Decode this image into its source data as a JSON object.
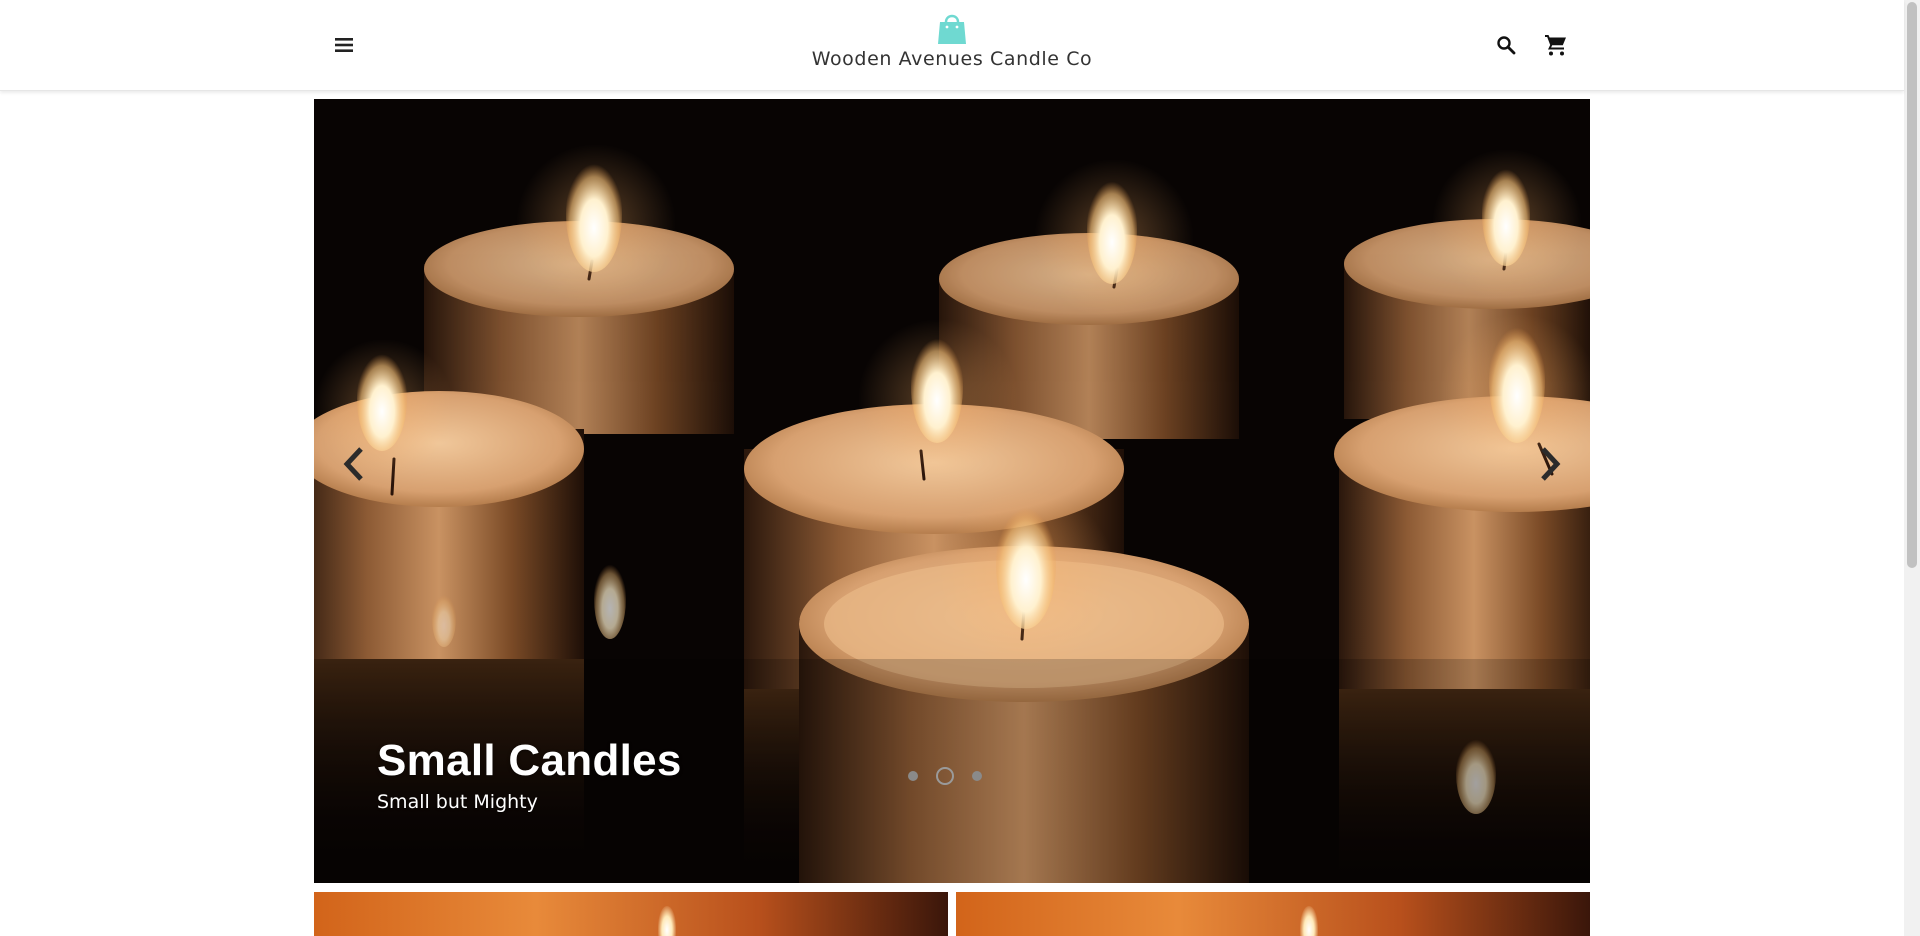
{
  "header": {
    "store_name": "Wooden Avenues Candle Co",
    "menu_icon": "hamburger-menu-icon",
    "logo_icon": "shopping-bag-icon",
    "search_icon": "search-icon",
    "cart_icon": "shopping-cart-icon"
  },
  "hero": {
    "title": "Small Candles",
    "subtitle": "Small but Mighty",
    "slide_count": 3,
    "active_slide": 2,
    "prev_icon": "chevron-left-icon",
    "next_icon": "chevron-right-icon"
  },
  "colors": {
    "brand_accent": "#6fd9d1",
    "header_text": "#333333"
  }
}
